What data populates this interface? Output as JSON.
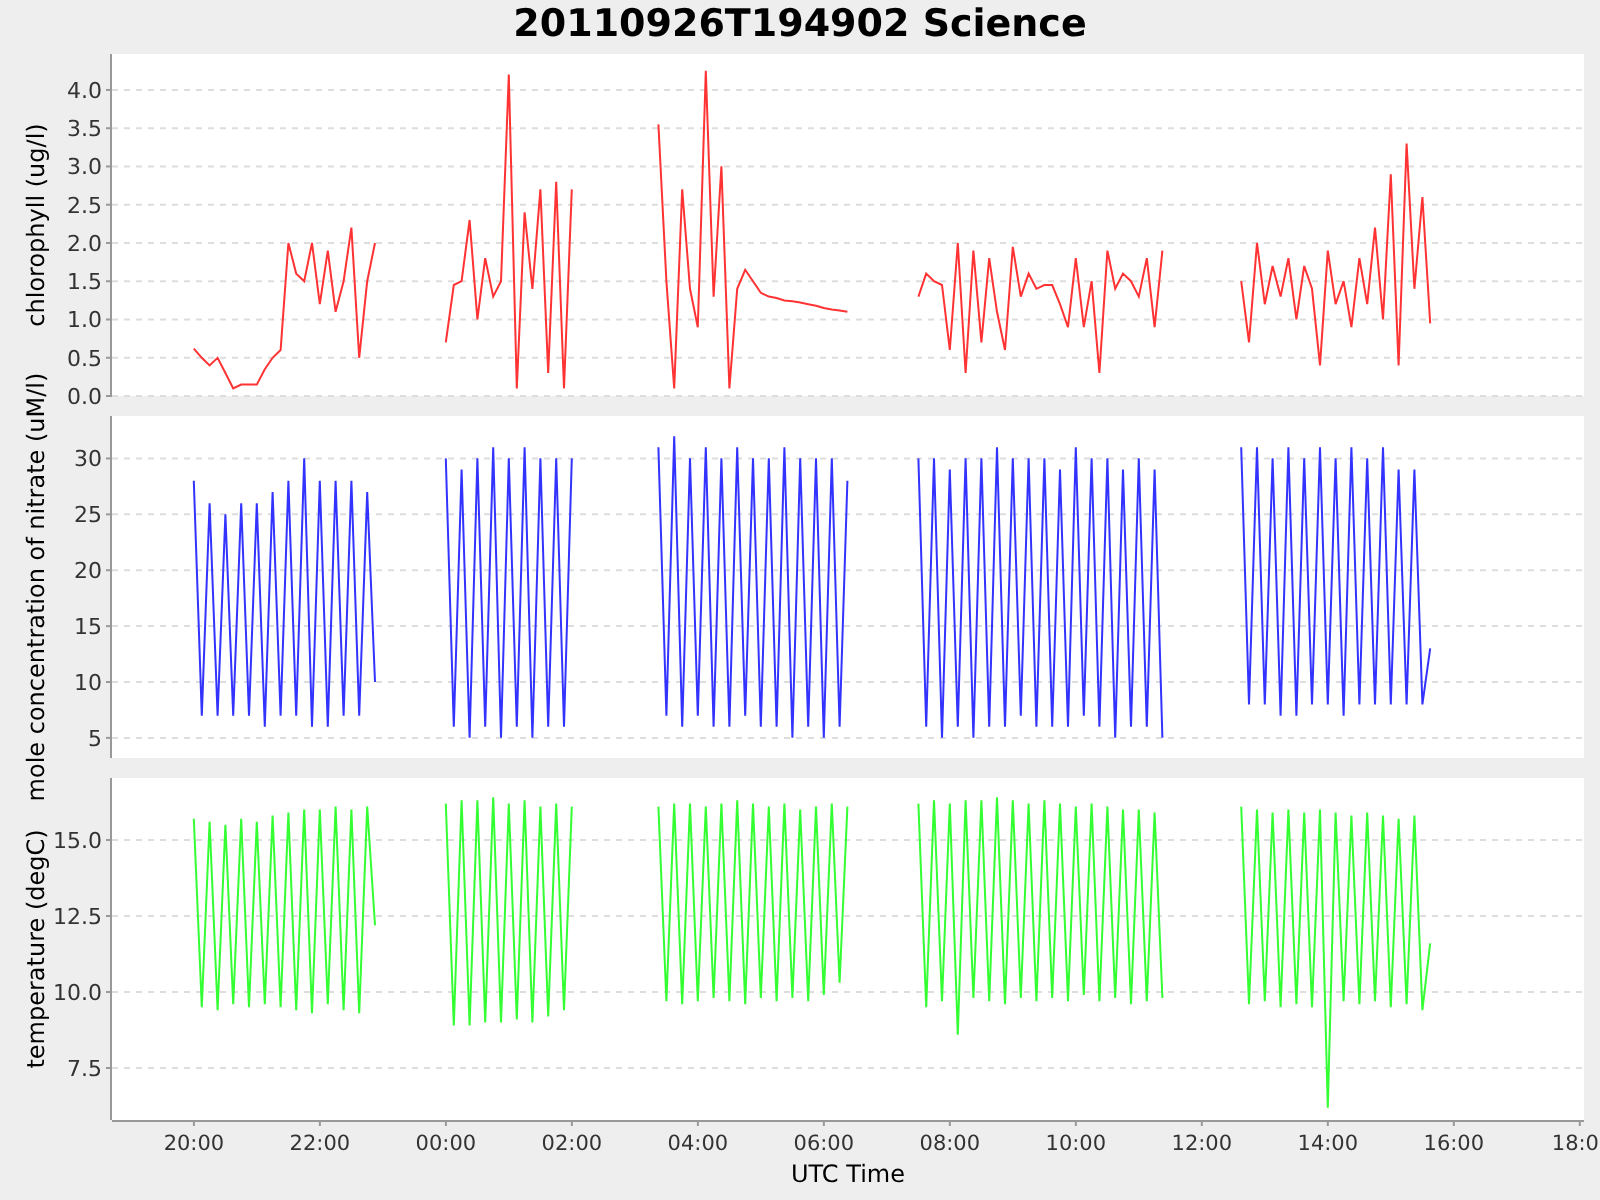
{
  "title": "20110926T194902 Science",
  "panels": [
    {
      "chart_data": {
        "type": "line",
        "grid": true,
        "ylabel": "chlorophyll (ug/l)",
        "xlim": [
          "2011-09-26T18:42:00",
          "2011-09-27T18:04:00"
        ],
        "ylim": [
          0,
          4.47
        ],
        "yticks": [
          {
            "value": 0,
            "label": "0.0"
          },
          {
            "value": 0.5,
            "label": "0.5"
          },
          {
            "value": 1,
            "label": "1.0"
          },
          {
            "value": 1.5,
            "label": "1.5"
          },
          {
            "value": 2,
            "label": "2.0"
          },
          {
            "value": 2.5,
            "label": "2.5"
          },
          {
            "value": 3,
            "label": "3.0"
          },
          {
            "value": 3.5,
            "label": "3.5"
          },
          {
            "value": 4,
            "label": "4.0"
          }
        ],
        "x": [
          "2011-09-26T20:00:00",
          "2011-09-26T20:07:30",
          "2011-09-26T20:15:00",
          "2011-09-26T20:22:30",
          "2011-09-26T20:30:00",
          "2011-09-26T20:37:30",
          "2011-09-26T20:45:00",
          "2011-09-26T20:52:30",
          "2011-09-26T21:00:00",
          "2011-09-26T21:07:30",
          "2011-09-26T21:15:00",
          "2011-09-26T21:22:30",
          "2011-09-26T21:30:00",
          "2011-09-26T21:37:30",
          "2011-09-26T21:45:00",
          "2011-09-26T21:52:30",
          "2011-09-26T22:00:00",
          "2011-09-26T22:07:30",
          "2011-09-26T22:15:00",
          "2011-09-26T22:22:30",
          "2011-09-26T22:30:00",
          "2011-09-26T22:37:30",
          "2011-09-26T22:45:00",
          "2011-09-26T22:52:30",
          "2011-09-26T23:00:00",
          "2011-09-26T23:07:30",
          "2011-09-26T23:15:00",
          "2011-09-26T23:22:30",
          "2011-09-26T23:30:00",
          "2011-09-26T23:37:30",
          "2011-09-26T23:45:00",
          "2011-09-26T23:52:30",
          "2011-09-27T00:00:00",
          "2011-09-27T00:07:30",
          "2011-09-27T00:15:00",
          "2011-09-27T00:22:30",
          "2011-09-27T00:30:00",
          "2011-09-27T00:37:30",
          "2011-09-27T00:45:00",
          "2011-09-27T00:52:30",
          "2011-09-27T01:00:00",
          "2011-09-27T01:07:30",
          "2011-09-27T01:15:00",
          "2011-09-27T01:22:30",
          "2011-09-27T01:30:00",
          "2011-09-27T01:37:30",
          "2011-09-27T01:45:00",
          "2011-09-27T01:52:30",
          "2011-09-27T02:00:00",
          "2011-09-27T02:07:30",
          "2011-09-27T02:15:00",
          "2011-09-27T02:22:30",
          "2011-09-27T02:30:00",
          "2011-09-27T02:37:30",
          "2011-09-27T02:45:00",
          "2011-09-27T02:52:30",
          "2011-09-27T03:00:00",
          "2011-09-27T03:07:30",
          "2011-09-27T03:15:00",
          "2011-09-27T03:22:30",
          "2011-09-27T03:30:00",
          "2011-09-27T03:37:30",
          "2011-09-27T03:45:00",
          "2011-09-27T03:52:30",
          "2011-09-27T04:00:00",
          "2011-09-27T04:07:30",
          "2011-09-27T04:15:00",
          "2011-09-27T04:22:30",
          "2011-09-27T04:30:00",
          "2011-09-27T04:37:30",
          "2011-09-27T04:45:00",
          "2011-09-27T04:52:30",
          "2011-09-27T05:00:00",
          "2011-09-27T05:07:30",
          "2011-09-27T05:15:00",
          "2011-09-27T05:22:30",
          "2011-09-27T05:30:00",
          "2011-09-27T05:37:30",
          "2011-09-27T05:45:00",
          "2011-09-27T05:52:30",
          "2011-09-27T06:00:00",
          "2011-09-27T06:07:30",
          "2011-09-27T06:15:00",
          "2011-09-27T06:22:30",
          "2011-09-27T06:30:00",
          "2011-09-27T06:37:30",
          "2011-09-27T06:45:00",
          "2011-09-27T06:52:30",
          "2011-09-27T07:00:00",
          "2011-09-27T07:07:30",
          "2011-09-27T07:15:00",
          "2011-09-27T07:22:30",
          "2011-09-27T07:30:00",
          "2011-09-27T07:37:30",
          "2011-09-27T07:45:00",
          "2011-09-27T07:52:30",
          "2011-09-27T08:00:00",
          "2011-09-27T08:07:30",
          "2011-09-27T08:15:00",
          "2011-09-27T08:22:30",
          "2011-09-27T08:30:00",
          "2011-09-27T08:37:30",
          "2011-09-27T08:45:00",
          "2011-09-27T08:52:30",
          "2011-09-27T09:00:00",
          "2011-09-27T09:07:30",
          "2011-09-27T09:15:00",
          "2011-09-27T09:22:30",
          "2011-09-27T09:30:00",
          "2011-09-27T09:37:30",
          "2011-09-27T09:45:00",
          "2011-09-27T09:52:30",
          "2011-09-27T10:00:00",
          "2011-09-27T10:07:30",
          "2011-09-27T10:15:00",
          "2011-09-27T10:22:30",
          "2011-09-27T10:30:00",
          "2011-09-27T10:37:30",
          "2011-09-27T10:45:00",
          "2011-09-27T10:52:30",
          "2011-09-27T11:00:00",
          "2011-09-27T11:07:30",
          "2011-09-27T11:15:00",
          "2011-09-27T11:22:30",
          "2011-09-27T11:30:00",
          "2011-09-27T11:37:30",
          "2011-09-27T11:45:00",
          "2011-09-27T11:52:30",
          "2011-09-27T12:00:00",
          "2011-09-27T12:07:30",
          "2011-09-27T12:15:00",
          "2011-09-27T12:22:30",
          "2011-09-27T12:30:00",
          "2011-09-27T12:37:30",
          "2011-09-27T12:45:00",
          "2011-09-27T12:52:30",
          "2011-09-27T13:00:00",
          "2011-09-27T13:07:30",
          "2011-09-27T13:15:00",
          "2011-09-27T13:22:30",
          "2011-09-27T13:30:00",
          "2011-09-27T13:37:30",
          "2011-09-27T13:45:00",
          "2011-09-27T13:52:30",
          "2011-09-27T14:00:00",
          "2011-09-27T14:07:30",
          "2011-09-27T14:15:00",
          "2011-09-27T14:22:30",
          "2011-09-27T14:30:00",
          "2011-09-27T14:37:30",
          "2011-09-27T14:45:00",
          "2011-09-27T14:52:30",
          "2011-09-27T15:00:00",
          "2011-09-27T15:07:30",
          "2011-09-27T15:15:00",
          "2011-09-27T15:22:30",
          "2011-09-27T15:30:00",
          "2011-09-27T15:37:30"
        ],
        "series": [
          {
            "color": "#ff3333",
            "values": [
              0.62,
              0.5,
              0.4,
              0.5,
              0.3,
              0.1,
              0.15,
              0.15,
              0.15,
              0.35,
              0.5,
              0.6,
              2.0,
              1.6,
              1.5,
              2.0,
              1.2,
              1.9,
              1.1,
              1.5,
              2.2,
              0.5,
              1.5,
              2.0,
              null,
              null,
              null,
              null,
              null,
              null,
              null,
              null,
              0.7,
              1.45,
              1.5,
              2.3,
              1.0,
              1.8,
              1.3,
              1.5,
              4.2,
              0.1,
              2.4,
              1.4,
              2.7,
              0.3,
              2.8,
              0.1,
              2.7,
              null,
              null,
              null,
              null,
              null,
              null,
              null,
              null,
              null,
              null,
              3.55,
              1.5,
              0.1,
              2.7,
              1.4,
              0.9,
              4.25,
              1.3,
              3.0,
              0.1,
              1.4,
              1.65,
              1.5,
              1.35,
              1.3,
              1.28,
              1.25,
              1.24,
              1.22,
              1.2,
              1.18,
              1.15,
              1.13,
              1.12,
              1.1,
              null,
              null,
              null,
              null,
              null,
              null,
              null,
              null,
              1.3,
              1.6,
              1.5,
              1.45,
              0.6,
              2.0,
              0.3,
              1.9,
              0.7,
              1.8,
              1.1,
              0.6,
              1.95,
              1.3,
              1.6,
              1.4,
              1.45,
              1.45,
              1.2,
              0.9,
              1.8,
              0.9,
              1.5,
              0.3,
              1.9,
              1.4,
              1.6,
              1.5,
              1.3,
              1.8,
              0.9,
              1.9,
              null,
              null,
              null,
              null,
              null,
              null,
              null,
              null,
              null,
              1.5,
              0.7,
              2.0,
              1.2,
              1.7,
              1.3,
              1.8,
              1.0,
              1.7,
              1.4,
              0.4,
              1.9,
              1.2,
              1.5,
              0.9,
              1.8,
              1.2,
              2.2,
              1.0,
              2.9,
              0.4,
              3.3,
              1.4,
              2.6,
              0.95
            ]
          }
        ]
      }
    },
    {
      "chart_data": {
        "type": "line",
        "grid": true,
        "ylabel": "mole concentration of nitrate (uM/l)",
        "xlim": [
          "2011-09-26T18:42:00",
          "2011-09-27T18:04:00"
        ],
        "ylim": [
          3.2,
          33.8
        ],
        "yticks": [
          5,
          10,
          15,
          20,
          25,
          30
        ],
        "x": [
          "2011-09-26T20:00:00",
          "2011-09-26T20:07:30",
          "2011-09-26T20:15:00",
          "2011-09-26T20:22:30",
          "2011-09-26T20:30:00",
          "2011-09-26T20:37:30",
          "2011-09-26T20:45:00",
          "2011-09-26T20:52:30",
          "2011-09-26T21:00:00",
          "2011-09-26T21:07:30",
          "2011-09-26T21:15:00",
          "2011-09-26T21:22:30",
          "2011-09-26T21:30:00",
          "2011-09-26T21:37:30",
          "2011-09-26T21:45:00",
          "2011-09-26T21:52:30",
          "2011-09-26T22:00:00",
          "2011-09-26T22:07:30",
          "2011-09-26T22:15:00",
          "2011-09-26T22:22:30",
          "2011-09-26T22:30:00",
          "2011-09-26T22:37:30",
          "2011-09-26T22:45:00",
          "2011-09-26T22:52:30",
          "2011-09-26T23:00:00",
          "2011-09-26T23:07:30",
          "2011-09-26T23:15:00",
          "2011-09-26T23:22:30",
          "2011-09-26T23:30:00",
          "2011-09-26T23:37:30",
          "2011-09-26T23:45:00",
          "2011-09-26T23:52:30",
          "2011-09-27T00:00:00",
          "2011-09-27T00:07:30",
          "2011-09-27T00:15:00",
          "2011-09-27T00:22:30",
          "2011-09-27T00:30:00",
          "2011-09-27T00:37:30",
          "2011-09-27T00:45:00",
          "2011-09-27T00:52:30",
          "2011-09-27T01:00:00",
          "2011-09-27T01:07:30",
          "2011-09-27T01:15:00",
          "2011-09-27T01:22:30",
          "2011-09-27T01:30:00",
          "2011-09-27T01:37:30",
          "2011-09-27T01:45:00",
          "2011-09-27T01:52:30",
          "2011-09-27T02:00:00",
          "2011-09-27T02:07:30",
          "2011-09-27T02:15:00",
          "2011-09-27T02:22:30",
          "2011-09-27T02:30:00",
          "2011-09-27T02:37:30",
          "2011-09-27T02:45:00",
          "2011-09-27T02:52:30",
          "2011-09-27T03:00:00",
          "2011-09-27T03:07:30",
          "2011-09-27T03:15:00",
          "2011-09-27T03:22:30",
          "2011-09-27T03:30:00",
          "2011-09-27T03:37:30",
          "2011-09-27T03:45:00",
          "2011-09-27T03:52:30",
          "2011-09-27T04:00:00",
          "2011-09-27T04:07:30",
          "2011-09-27T04:15:00",
          "2011-09-27T04:22:30",
          "2011-09-27T04:30:00",
          "2011-09-27T04:37:30",
          "2011-09-27T04:45:00",
          "2011-09-27T04:52:30",
          "2011-09-27T05:00:00",
          "2011-09-27T05:07:30",
          "2011-09-27T05:15:00",
          "2011-09-27T05:22:30",
          "2011-09-27T05:30:00",
          "2011-09-27T05:37:30",
          "2011-09-27T05:45:00",
          "2011-09-27T05:52:30",
          "2011-09-27T06:00:00",
          "2011-09-27T06:07:30",
          "2011-09-27T06:15:00",
          "2011-09-27T06:22:30",
          "2011-09-27T06:30:00",
          "2011-09-27T06:37:30",
          "2011-09-27T06:45:00",
          "2011-09-27T06:52:30",
          "2011-09-27T07:00:00",
          "2011-09-27T07:07:30",
          "2011-09-27T07:15:00",
          "2011-09-27T07:22:30",
          "2011-09-27T07:30:00",
          "2011-09-27T07:37:30",
          "2011-09-27T07:45:00",
          "2011-09-27T07:52:30",
          "2011-09-27T08:00:00",
          "2011-09-27T08:07:30",
          "2011-09-27T08:15:00",
          "2011-09-27T08:22:30",
          "2011-09-27T08:30:00",
          "2011-09-27T08:37:30",
          "2011-09-27T08:45:00",
          "2011-09-27T08:52:30",
          "2011-09-27T09:00:00",
          "2011-09-27T09:07:30",
          "2011-09-27T09:15:00",
          "2011-09-27T09:22:30",
          "2011-09-27T09:30:00",
          "2011-09-27T09:37:30",
          "2011-09-27T09:45:00",
          "2011-09-27T09:52:30",
          "2011-09-27T10:00:00",
          "2011-09-27T10:07:30",
          "2011-09-27T10:15:00",
          "2011-09-27T10:22:30",
          "2011-09-27T10:30:00",
          "2011-09-27T10:37:30",
          "2011-09-27T10:45:00",
          "2011-09-27T10:52:30",
          "2011-09-27T11:00:00",
          "2011-09-27T11:07:30",
          "2011-09-27T11:15:00",
          "2011-09-27T11:22:30",
          "2011-09-27T11:30:00",
          "2011-09-27T11:37:30",
          "2011-09-27T11:45:00",
          "2011-09-27T11:52:30",
          "2011-09-27T12:00:00",
          "2011-09-27T12:07:30",
          "2011-09-27T12:15:00",
          "2011-09-27T12:22:30",
          "2011-09-27T12:30:00",
          "2011-09-27T12:37:30",
          "2011-09-27T12:45:00",
          "2011-09-27T12:52:30",
          "2011-09-27T13:00:00",
          "2011-09-27T13:07:30",
          "2011-09-27T13:15:00",
          "2011-09-27T13:22:30",
          "2011-09-27T13:30:00",
          "2011-09-27T13:37:30",
          "2011-09-27T13:45:00",
          "2011-09-27T13:52:30",
          "2011-09-27T14:00:00",
          "2011-09-27T14:07:30",
          "2011-09-27T14:15:00",
          "2011-09-27T14:22:30",
          "2011-09-27T14:30:00",
          "2011-09-27T14:37:30",
          "2011-09-27T14:45:00",
          "2011-09-27T14:52:30",
          "2011-09-27T15:00:00",
          "2011-09-27T15:07:30",
          "2011-09-27T15:15:00",
          "2011-09-27T15:22:30",
          "2011-09-27T15:30:00",
          "2011-09-27T15:37:30"
        ],
        "series": [
          {
            "color": "#3333ff",
            "values": [
              28,
              7,
              26,
              7,
              25,
              7,
              26,
              7,
              26,
              6,
              27,
              7,
              28,
              7,
              30,
              6,
              28,
              6,
              28,
              7,
              28,
              7,
              27,
              10,
              null,
              null,
              null,
              null,
              null,
              null,
              null,
              null,
              30,
              6,
              29,
              5,
              30,
              6,
              31,
              5,
              30,
              6,
              31,
              5,
              30,
              6,
              30,
              6,
              30,
              null,
              null,
              null,
              null,
              null,
              null,
              null,
              null,
              null,
              null,
              31,
              7,
              32,
              6,
              30,
              7,
              31,
              6,
              30,
              6,
              31,
              7,
              30,
              6,
              30,
              6,
              31,
              5,
              30,
              6,
              30,
              5,
              30,
              6,
              28,
              null,
              null,
              null,
              null,
              null,
              null,
              null,
              null,
              30,
              6,
              30,
              5,
              29,
              6,
              30,
              5,
              30,
              6,
              31,
              6,
              30,
              7,
              30,
              6,
              30,
              6,
              29,
              6,
              31,
              7,
              30,
              6,
              30,
              5,
              29,
              6,
              30,
              6,
              29,
              5,
              null,
              null,
              null,
              null,
              null,
              null,
              null,
              null,
              null,
              31,
              8,
              31,
              8,
              30,
              7,
              31,
              7,
              30,
              8,
              31,
              8,
              30,
              7,
              31,
              8,
              30,
              8,
              31,
              8,
              29,
              8,
              29,
              8,
              13
            ]
          }
        ]
      }
    },
    {
      "chart_data": {
        "type": "line",
        "grid": true,
        "ylabel": "temperature (degC)",
        "xlabel": "UTC Time",
        "xlim": [
          "2011-09-26T18:42:00",
          "2011-09-27T18:04:00"
        ],
        "ylim": [
          5.79,
          17.04
        ],
        "yticks": [
          {
            "value": 7.5,
            "label": "7.5"
          },
          {
            "value": 10,
            "label": "10.0"
          },
          {
            "value": 12.5,
            "label": "12.5"
          },
          {
            "value": 15,
            "label": "15.0"
          }
        ],
        "xticks": [
          {
            "value": "2011-09-26T20:00:00",
            "label": "20:00"
          },
          {
            "value": "2011-09-26T22:00:00",
            "label": "22:00"
          },
          {
            "value": "2011-09-27T00:00:00",
            "label": "00:00"
          },
          {
            "value": "2011-09-27T02:00:00",
            "label": "02:00"
          },
          {
            "value": "2011-09-27T04:00:00",
            "label": "04:00"
          },
          {
            "value": "2011-09-27T06:00:00",
            "label": "06:00"
          },
          {
            "value": "2011-09-27T08:00:00",
            "label": "08:00"
          },
          {
            "value": "2011-09-27T10:00:00",
            "label": "10:00"
          },
          {
            "value": "2011-09-27T12:00:00",
            "label": "12:00"
          },
          {
            "value": "2011-09-27T14:00:00",
            "label": "14:00"
          },
          {
            "value": "2011-09-27T16:00:00",
            "label": "16:00"
          },
          {
            "value": "2011-09-27T18:00:00",
            "label": "18:0"
          }
        ],
        "x": [
          "2011-09-26T20:00:00",
          "2011-09-26T20:07:30",
          "2011-09-26T20:15:00",
          "2011-09-26T20:22:30",
          "2011-09-26T20:30:00",
          "2011-09-26T20:37:30",
          "2011-09-26T20:45:00",
          "2011-09-26T20:52:30",
          "2011-09-26T21:00:00",
          "2011-09-26T21:07:30",
          "2011-09-26T21:15:00",
          "2011-09-26T21:22:30",
          "2011-09-26T21:30:00",
          "2011-09-26T21:37:30",
          "2011-09-26T21:45:00",
          "2011-09-26T21:52:30",
          "2011-09-26T22:00:00",
          "2011-09-26T22:07:30",
          "2011-09-26T22:15:00",
          "2011-09-26T22:22:30",
          "2011-09-26T22:30:00",
          "2011-09-26T22:37:30",
          "2011-09-26T22:45:00",
          "2011-09-26T22:52:30",
          "2011-09-26T23:00:00",
          "2011-09-26T23:07:30",
          "2011-09-26T23:15:00",
          "2011-09-26T23:22:30",
          "2011-09-26T23:30:00",
          "2011-09-26T23:37:30",
          "2011-09-26T23:45:00",
          "2011-09-26T23:52:30",
          "2011-09-27T00:00:00",
          "2011-09-27T00:07:30",
          "2011-09-27T00:15:00",
          "2011-09-27T00:22:30",
          "2011-09-27T00:30:00",
          "2011-09-27T00:37:30",
          "2011-09-27T00:45:00",
          "2011-09-27T00:52:30",
          "2011-09-27T01:00:00",
          "2011-09-27T01:07:30",
          "2011-09-27T01:15:00",
          "2011-09-27T01:22:30",
          "2011-09-27T01:30:00",
          "2011-09-27T01:37:30",
          "2011-09-27T01:45:00",
          "2011-09-27T01:52:30",
          "2011-09-27T02:00:00",
          "2011-09-27T02:07:30",
          "2011-09-27T02:15:00",
          "2011-09-27T02:22:30",
          "2011-09-27T02:30:00",
          "2011-09-27T02:37:30",
          "2011-09-27T02:45:00",
          "2011-09-27T02:52:30",
          "2011-09-27T03:00:00",
          "2011-09-27T03:07:30",
          "2011-09-27T03:15:00",
          "2011-09-27T03:22:30",
          "2011-09-27T03:30:00",
          "2011-09-27T03:37:30",
          "2011-09-27T03:45:00",
          "2011-09-27T03:52:30",
          "2011-09-27T04:00:00",
          "2011-09-27T04:07:30",
          "2011-09-27T04:15:00",
          "2011-09-27T04:22:30",
          "2011-09-27T04:30:00",
          "2011-09-27T04:37:30",
          "2011-09-27T04:45:00",
          "2011-09-27T04:52:30",
          "2011-09-27T05:00:00",
          "2011-09-27T05:07:30",
          "2011-09-27T05:15:00",
          "2011-09-27T05:22:30",
          "2011-09-27T05:30:00",
          "2011-09-27T05:37:30",
          "2011-09-27T05:45:00",
          "2011-09-27T05:52:30",
          "2011-09-27T06:00:00",
          "2011-09-27T06:07:30",
          "2011-09-27T06:15:00",
          "2011-09-27T06:22:30",
          "2011-09-27T06:30:00",
          "2011-09-27T06:37:30",
          "2011-09-27T06:45:00",
          "2011-09-27T06:52:30",
          "2011-09-27T07:00:00",
          "2011-09-27T07:07:30",
          "2011-09-27T07:15:00",
          "2011-09-27T07:22:30",
          "2011-09-27T07:30:00",
          "2011-09-27T07:37:30",
          "2011-09-27T07:45:00",
          "2011-09-27T07:52:30",
          "2011-09-27T08:00:00",
          "2011-09-27T08:07:30",
          "2011-09-27T08:15:00",
          "2011-09-27T08:22:30",
          "2011-09-27T08:30:00",
          "2011-09-27T08:37:30",
          "2011-09-27T08:45:00",
          "2011-09-27T08:52:30",
          "2011-09-27T09:00:00",
          "2011-09-27T09:07:30",
          "2011-09-27T09:15:00",
          "2011-09-27T09:22:30",
          "2011-09-27T09:30:00",
          "2011-09-27T09:37:30",
          "2011-09-27T09:45:00",
          "2011-09-27T09:52:30",
          "2011-09-27T10:00:00",
          "2011-09-27T10:07:30",
          "2011-09-27T10:15:00",
          "2011-09-27T10:22:30",
          "2011-09-27T10:30:00",
          "2011-09-27T10:37:30",
          "2011-09-27T10:45:00",
          "2011-09-27T10:52:30",
          "2011-09-27T11:00:00",
          "2011-09-27T11:07:30",
          "2011-09-27T11:15:00",
          "2011-09-27T11:22:30",
          "2011-09-27T11:30:00",
          "2011-09-27T11:37:30",
          "2011-09-27T11:45:00",
          "2011-09-27T11:52:30",
          "2011-09-27T12:00:00",
          "2011-09-27T12:07:30",
          "2011-09-27T12:15:00",
          "2011-09-27T12:22:30",
          "2011-09-27T12:30:00",
          "2011-09-27T12:37:30",
          "2011-09-27T12:45:00",
          "2011-09-27T12:52:30",
          "2011-09-27T13:00:00",
          "2011-09-27T13:07:30",
          "2011-09-27T13:15:00",
          "2011-09-27T13:22:30",
          "2011-09-27T13:30:00",
          "2011-09-27T13:37:30",
          "2011-09-27T13:45:00",
          "2011-09-27T13:52:30",
          "2011-09-27T14:00:00",
          "2011-09-27T14:07:30",
          "2011-09-27T14:15:00",
          "2011-09-27T14:22:30",
          "2011-09-27T14:30:00",
          "2011-09-27T14:37:30",
          "2011-09-27T14:45:00",
          "2011-09-27T14:52:30",
          "2011-09-27T15:00:00",
          "2011-09-27T15:07:30",
          "2011-09-27T15:15:00",
          "2011-09-27T15:22:30",
          "2011-09-27T15:30:00",
          "2011-09-27T15:37:30"
        ],
        "series": [
          {
            "color": "#33ff33",
            "values": [
              15.7,
              9.5,
              15.6,
              9.4,
              15.5,
              9.6,
              15.7,
              9.5,
              15.6,
              9.6,
              15.8,
              9.5,
              15.9,
              9.4,
              16.0,
              9.3,
              16.0,
              9.6,
              16.1,
              9.4,
              16.0,
              9.3,
              16.1,
              12.2,
              null,
              null,
              null,
              null,
              null,
              null,
              null,
              null,
              16.2,
              8.9,
              16.3,
              8.9,
              16.3,
              9.0,
              16.4,
              9.0,
              16.2,
              9.1,
              16.3,
              9.0,
              16.1,
              9.2,
              16.2,
              9.4,
              16.1,
              null,
              null,
              null,
              null,
              null,
              null,
              null,
              null,
              null,
              null,
              16.1,
              9.7,
              16.2,
              9.6,
              16.2,
              9.7,
              16.1,
              9.8,
              16.2,
              9.7,
              16.3,
              9.6,
              16.2,
              9.8,
              16.1,
              9.7,
              16.2,
              9.8,
              16.0,
              9.7,
              16.1,
              9.9,
              16.2,
              10.3,
              16.1,
              null,
              null,
              null,
              null,
              null,
              null,
              null,
              null,
              16.2,
              9.5,
              16.3,
              9.7,
              16.2,
              8.6,
              16.3,
              9.8,
              16.3,
              9.7,
              16.4,
              9.6,
              16.3,
              9.8,
              16.2,
              9.7,
              16.3,
              9.8,
              16.2,
              9.7,
              16.1,
              9.9,
              16.2,
              9.7,
              16.1,
              9.8,
              16.0,
              9.6,
              16.0,
              9.7,
              15.9,
              9.8,
              null,
              null,
              null,
              null,
              null,
              null,
              null,
              null,
              null,
              16.1,
              9.6,
              16.0,
              9.7,
              15.9,
              9.5,
              16.0,
              9.6,
              15.9,
              9.5,
              16.0,
              6.2,
              15.9,
              9.7,
              15.8,
              9.6,
              15.9,
              9.7,
              15.8,
              9.5,
              15.7,
              9.6,
              15.8,
              9.4,
              11.6
            ]
          }
        ]
      }
    }
  ]
}
